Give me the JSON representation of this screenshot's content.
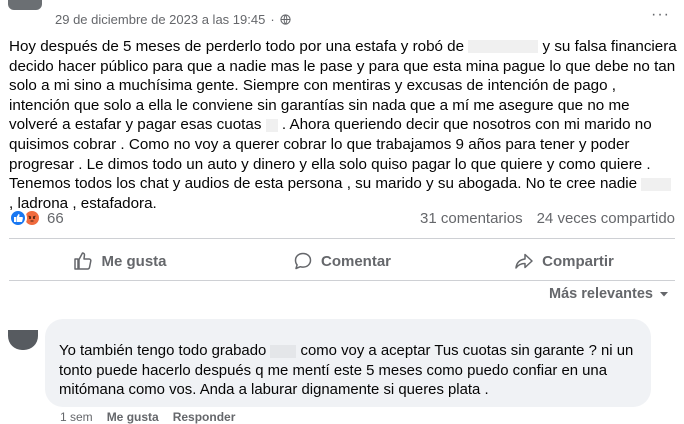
{
  "post": {
    "timestamp": "29 de diciembre de 2023 a las 19:45",
    "dot": "·",
    "more": "···",
    "text_parts": [
      "Hoy después de 5 meses de perderlo todo por una estafa y robó de ",
      " y su falsa financiera decido hacer público para que a nadie mas le pase y para  que esta mina pague lo que debe no tan solo a mi sino a muchísima gente. Siempre con mentiras y excusas de intención de pago , intención que solo a ella le conviene sin garantías sin nada que a mí me asegure que no me volveré a estafar y pagar esas cuotas ",
      " . Ahora queriendo decir que nosotros con mi marido no quisimos cobrar . Como no voy a querer cobrar lo que trabajamos 9 años para tener y poder progresar . Le dimos todo un auto y dinero y ella solo quiso pagar lo que quiere y como quiere . Tenemos todos los chat y audios de esta persona , su marido y su abogada. No te cree nadie ",
      " , ladrona , estafadora."
    ]
  },
  "stats": {
    "reaction_count": "66",
    "comments": "31 comentarios",
    "shares": "24 veces compartido"
  },
  "actions": {
    "like": "Me gusta",
    "comment": "Comentar",
    "share": "Compartir"
  },
  "sort": {
    "label": "Más relevantes"
  },
  "comment": {
    "text_parts": [
      "Yo también tengo todo grabado ",
      " como voy a aceptar Tus cuotas sin garante ? ni un tonto puede hacerlo después q me mentí este 5 meses como puedo confiar en una mitómana como vos. Anda a laburar dignamente si queres plata ."
    ],
    "time": "1 sem",
    "like": "Me gusta",
    "reply": "Responder"
  }
}
